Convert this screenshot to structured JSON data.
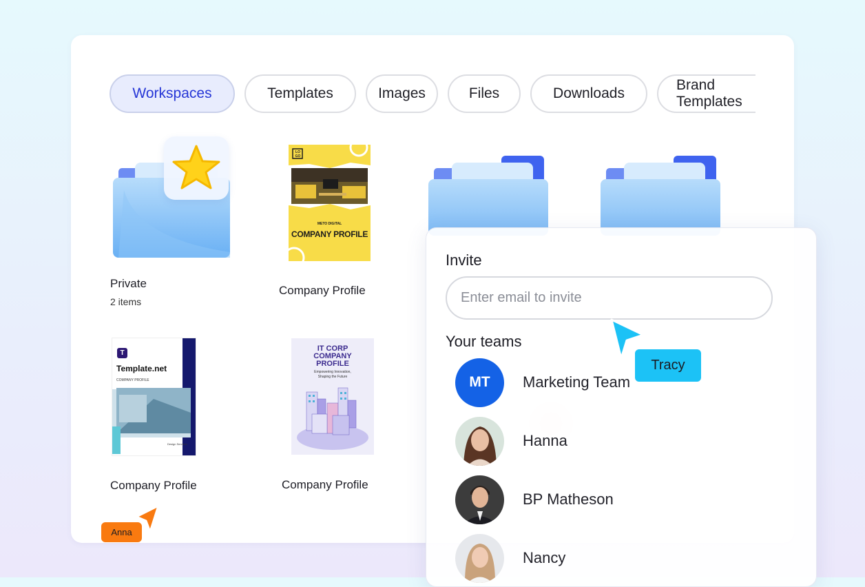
{
  "tabs": [
    {
      "label": "Workspaces",
      "active": true
    },
    {
      "label": "Templates"
    },
    {
      "label": "Images"
    },
    {
      "label": "Files"
    },
    {
      "label": "Downloads"
    },
    {
      "label": "Brand Templates"
    }
  ],
  "items": {
    "private": {
      "name": "Private",
      "count": "2 items"
    },
    "profile_yellow": {
      "name": "Company Profile",
      "logo_text": "LO GO",
      "brand": "METO DIGITAL",
      "title": "COMPANY PROFILE"
    },
    "profile_template": {
      "name": "Company Profile",
      "brand": "Template.net",
      "subtitle": "COMPANY PROFILE",
      "footer": "Design Services"
    },
    "profile_itcorp": {
      "name": "Company Profile",
      "title_line1": "IT CORP",
      "title_line2": "COMPANY",
      "title_line3": "PROFILE",
      "tagline_line1": "Empowering Innovation,",
      "tagline_line2": "Shaping the Future"
    }
  },
  "invite": {
    "title": "Invite",
    "placeholder": "Enter email to invite",
    "teams_title": "Your teams",
    "members": [
      {
        "name": "Marketing Team",
        "initials": "MT"
      },
      {
        "name": "Hanna"
      },
      {
        "name": "BP Matheson"
      },
      {
        "name": "Nancy"
      }
    ]
  },
  "cursors": [
    {
      "name": "Tracy",
      "color": "#1cc2f6"
    },
    {
      "name": "Anna",
      "color": "#f97a10"
    }
  ],
  "colors": {
    "accent": "#2636d6",
    "team_avatar": "#1462e6",
    "folder_blue": "#6fb6f6",
    "star": "#ffd21a"
  }
}
